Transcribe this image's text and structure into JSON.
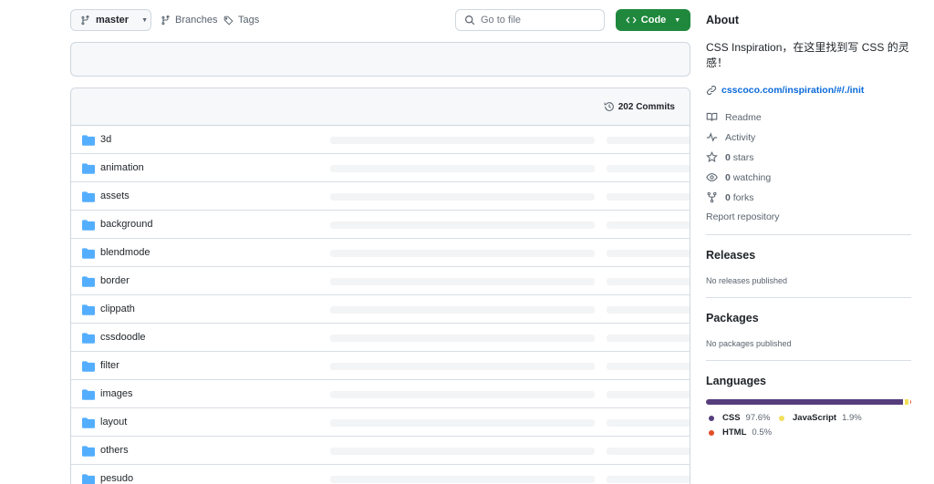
{
  "toolbar": {
    "branch": "master",
    "branches_label": "Branches",
    "tags_label": "Tags",
    "search_placeholder": "Go to file",
    "code_label": "Code"
  },
  "files_header": {
    "commits_label": "202 Commits"
  },
  "files": [
    {
      "name": "3d"
    },
    {
      "name": "animation"
    },
    {
      "name": "assets"
    },
    {
      "name": "background"
    },
    {
      "name": "blendmode"
    },
    {
      "name": "border"
    },
    {
      "name": "clippath"
    },
    {
      "name": "cssdoodle"
    },
    {
      "name": "filter"
    },
    {
      "name": "images"
    },
    {
      "name": "layout"
    },
    {
      "name": "others"
    },
    {
      "name": "pesudo"
    }
  ],
  "about": {
    "title": "About",
    "description": "CSS Inspiration，在这里找到写 CSS 的灵感！",
    "link": "csscoco.com/inspiration/#/./init",
    "readme_label": "Readme",
    "activity_label": "Activity",
    "stars_count": "0",
    "stars_label": "stars",
    "watching_count": "0",
    "watching_label": "watching",
    "forks_count": "0",
    "forks_label": "forks",
    "report_label": "Report repository"
  },
  "releases": {
    "title": "Releases",
    "note": "No releases published"
  },
  "packages": {
    "title": "Packages",
    "note": "No packages published"
  },
  "languages": {
    "title": "Languages",
    "items": [
      {
        "name": "CSS",
        "percent": "97.6%",
        "color": "#563d7c",
        "share": 97.6
      },
      {
        "name": "JavaScript",
        "percent": "1.9%",
        "color": "#f1e05a",
        "share": 1.9
      },
      {
        "name": "HTML",
        "percent": "0.5%",
        "color": "#e34c26",
        "share": 0.5
      }
    ]
  },
  "colors": {
    "accent_green": "#1f883d",
    "link_blue": "#0969da",
    "folder_blue": "#54aeff"
  }
}
